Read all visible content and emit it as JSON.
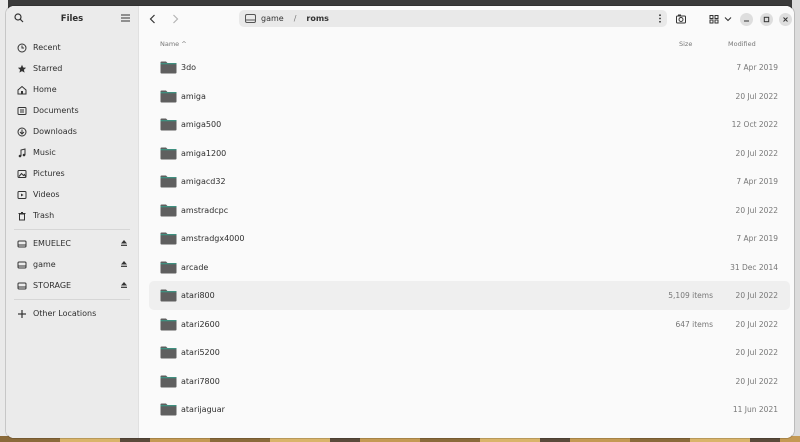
{
  "sidebar": {
    "title": "Files",
    "places": [
      {
        "label": "Recent",
        "icon": "clock-icon"
      },
      {
        "label": "Starred",
        "icon": "star-icon"
      },
      {
        "label": "Home",
        "icon": "home-icon"
      },
      {
        "label": "Documents",
        "icon": "document-icon"
      },
      {
        "label": "Downloads",
        "icon": "download-icon"
      },
      {
        "label": "Music",
        "icon": "music-icon"
      },
      {
        "label": "Pictures",
        "icon": "picture-icon"
      },
      {
        "label": "Videos",
        "icon": "video-icon"
      },
      {
        "label": "Trash",
        "icon": "trash-icon"
      }
    ],
    "devices": [
      {
        "label": "EMUELEC"
      },
      {
        "label": "game"
      },
      {
        "label": "STORAGE"
      }
    ],
    "other": "Other Locations"
  },
  "path": {
    "segments": [
      "game",
      "roms"
    ]
  },
  "columns": {
    "name": "Name",
    "size": "Size",
    "modified": "Modified"
  },
  "files": [
    {
      "name": "3do",
      "size": "",
      "modified": "7 Apr 2019"
    },
    {
      "name": "amiga",
      "size": "",
      "modified": "20 Jul 2022"
    },
    {
      "name": "amiga500",
      "size": "",
      "modified": "12 Oct 2022"
    },
    {
      "name": "amiga1200",
      "size": "",
      "modified": "20 Jul 2022"
    },
    {
      "name": "amigacd32",
      "size": "",
      "modified": "7 Apr 2019"
    },
    {
      "name": "amstradcpc",
      "size": "",
      "modified": "20 Jul 2022"
    },
    {
      "name": "amstradgx4000",
      "size": "",
      "modified": "7 Apr 2019"
    },
    {
      "name": "arcade",
      "size": "",
      "modified": "31 Dec 2014"
    },
    {
      "name": "atari800",
      "size": "5,109 items",
      "modified": "20 Jul 2022"
    },
    {
      "name": "atari2600",
      "size": "647 items",
      "modified": "20 Jul 2022"
    },
    {
      "name": "atari5200",
      "size": "",
      "modified": "20 Jul 2022"
    },
    {
      "name": "atari7800",
      "size": "",
      "modified": "20 Jul 2022"
    },
    {
      "name": "atarijaguar",
      "size": "",
      "modified": "11 Jun 2021"
    }
  ],
  "highlight_row": "atari800",
  "colors": {
    "folder": "#5f5f5f",
    "folder_top": "#3f8f7f",
    "accent": "#3584e4"
  }
}
